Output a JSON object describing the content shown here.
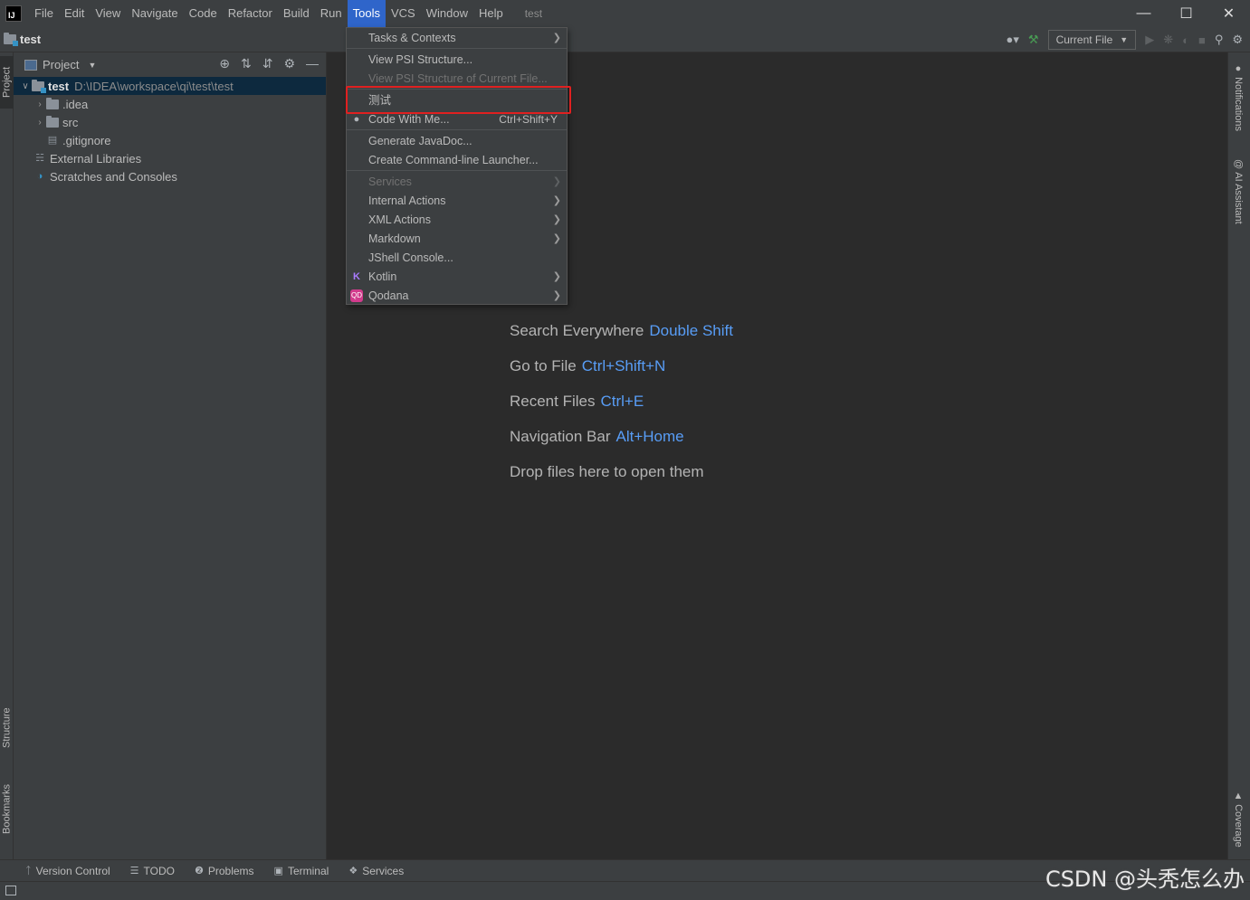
{
  "app": {
    "logo_text": "IJ",
    "window_title": "test"
  },
  "menu": [
    "File",
    "Edit",
    "View",
    "Navigate",
    "Code",
    "Refactor",
    "Build",
    "Run",
    "Tools",
    "VCS",
    "Window",
    "Help"
  ],
  "menu_active": "Tools",
  "navbar": {
    "project": "test",
    "run_config": "Current File"
  },
  "project_panel": {
    "title": "Project",
    "tree": [
      {
        "label": "test",
        "path": "D:\\IDEA\\workspace\\qi\\test\\test",
        "level": 0,
        "expanded": true,
        "selected": true,
        "icon": "module-folder-icon"
      },
      {
        "label": ".idea",
        "level": 1,
        "expanded": false,
        "icon": "folder-icon"
      },
      {
        "label": "src",
        "level": 1,
        "expanded": false,
        "icon": "folder-icon"
      },
      {
        "label": ".gitignore",
        "level": 1,
        "icon": "gitignore-file-icon"
      },
      {
        "label": "External Libraries",
        "level": 0,
        "icon": "libraries-icon"
      },
      {
        "label": "Scratches and Consoles",
        "level": 0,
        "icon": "scratches-icon"
      }
    ]
  },
  "tools_menu": {
    "items": [
      {
        "label": "Tasks & Contexts",
        "submenu": true
      },
      {
        "label": "View PSI Structure..."
      },
      {
        "label": "View PSI Structure of Current File...",
        "disabled": true
      },
      {
        "label": "测试",
        "highlighted": true
      },
      {
        "label": "Code With Me...",
        "shortcut": "Ctrl+Shift+Y",
        "icon": "code-with-me-icon"
      },
      {
        "label": "Generate JavaDoc..."
      },
      {
        "label": "Create Command-line Launcher..."
      },
      {
        "label": "Services",
        "submenu": true,
        "disabled": true
      },
      {
        "label": "Internal Actions",
        "submenu": true
      },
      {
        "label": "XML Actions",
        "submenu": true
      },
      {
        "label": "Markdown",
        "submenu": true
      },
      {
        "label": "JShell Console..."
      },
      {
        "label": "Kotlin",
        "submenu": true,
        "icon": "kotlin-icon"
      },
      {
        "label": "Qodana",
        "submenu": true,
        "icon": "qodana-icon"
      }
    ]
  },
  "editor_hints": [
    {
      "text": "Search Everywhere",
      "key": "Double Shift"
    },
    {
      "text": "Go to File",
      "key": "Ctrl+Shift+N"
    },
    {
      "text": "Recent Files",
      "key": "Ctrl+E"
    },
    {
      "text": "Navigation Bar",
      "key": "Alt+Home"
    },
    {
      "text": "Drop files here to open them",
      "key": ""
    }
  ],
  "left_tabs": [
    "Project",
    "Structure",
    "Bookmarks"
  ],
  "right_tabs": [
    "Notifications",
    "AI Assistant",
    "Coverage"
  ],
  "statusbar": [
    "Version Control",
    "TODO",
    "Problems",
    "Terminal",
    "Services"
  ],
  "watermark": "CSDN @头秃怎么办",
  "colors": {
    "accent": "#2f65ca",
    "link": "#589df6",
    "highlight_box": "#e02020",
    "bg": "#2b2b2b",
    "panel": "#3c3f41"
  }
}
